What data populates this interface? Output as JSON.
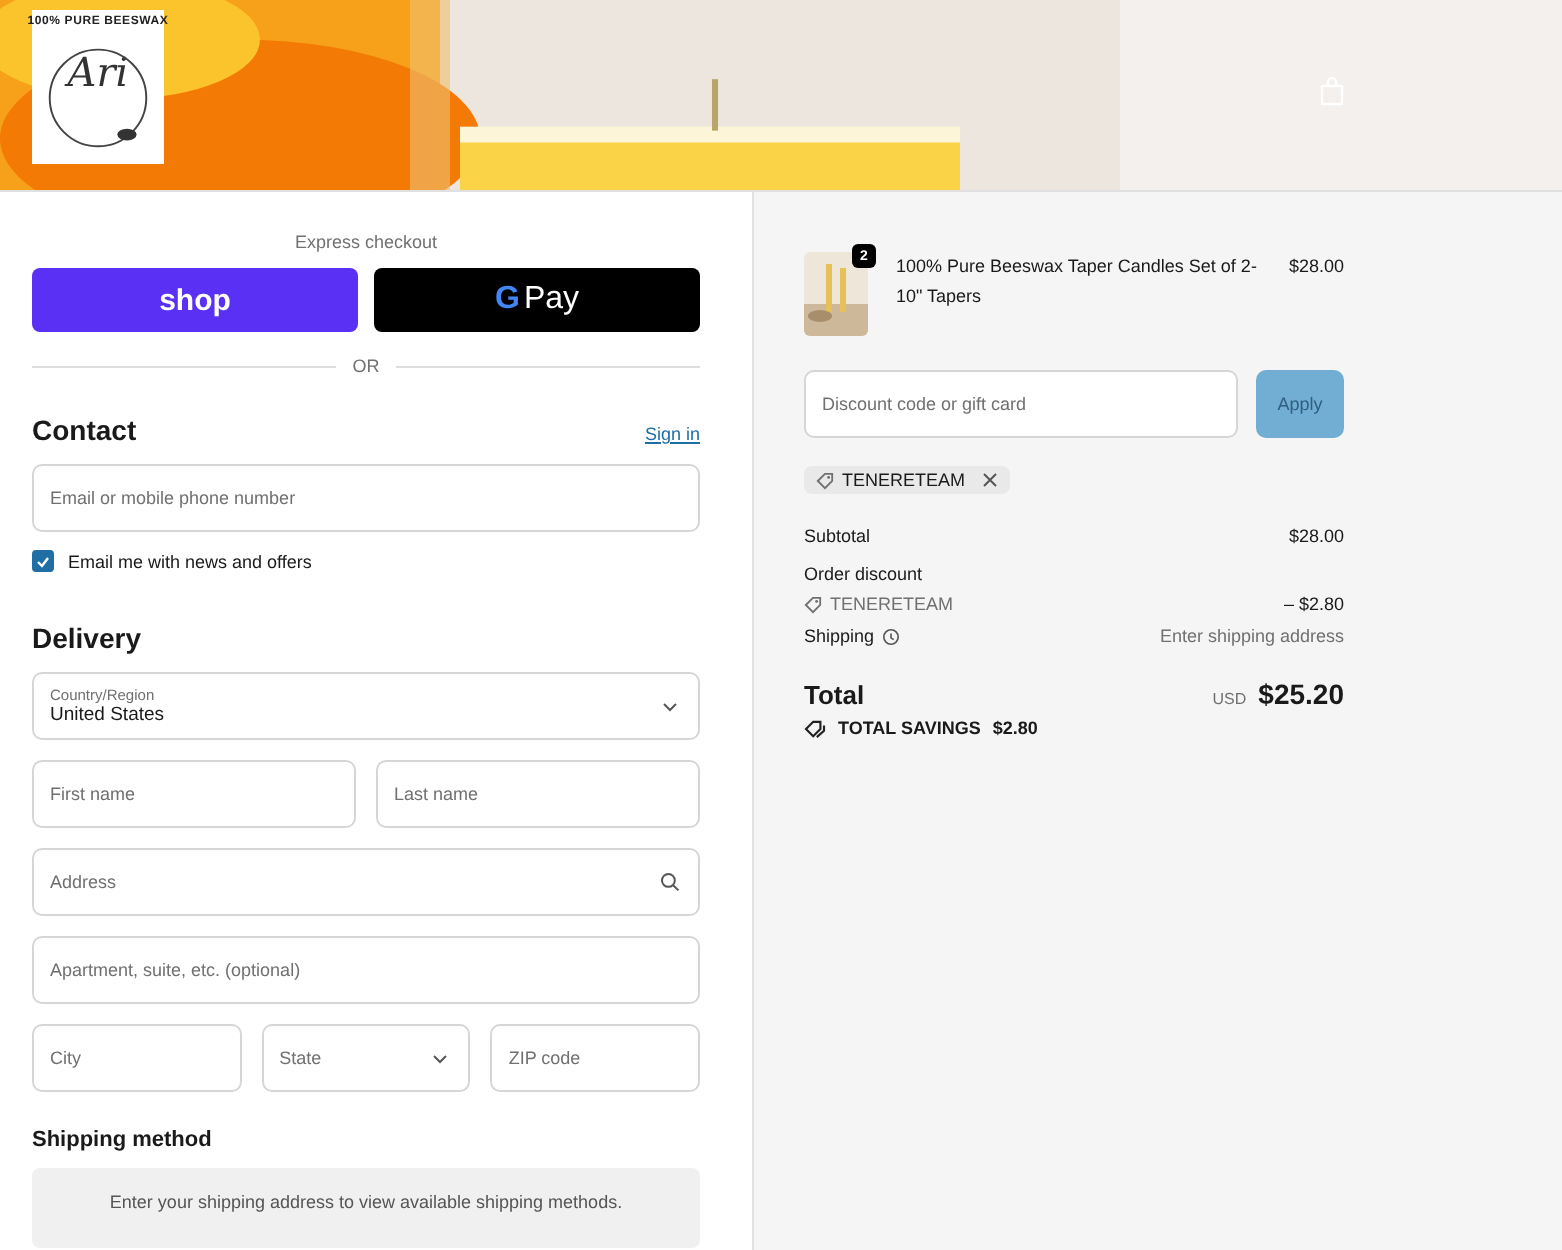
{
  "header": {
    "logo": {
      "arc_text": "100% PURE BEESWAX",
      "script_text": "Ari"
    }
  },
  "express": {
    "title": "Express checkout",
    "shop_label": "shop",
    "gpay": {
      "letter": "G",
      "label": "Pay"
    },
    "divider": "OR"
  },
  "contact": {
    "heading": "Contact",
    "sign_in": "Sign in",
    "email": {
      "placeholder": "Email or mobile phone number"
    },
    "newsletter": {
      "label": "Email me with news and offers",
      "checked": true
    }
  },
  "delivery": {
    "heading": "Delivery",
    "country": {
      "label": "Country/Region",
      "value": "United States"
    },
    "first_name": {
      "placeholder": "First name"
    },
    "last_name": {
      "placeholder": "Last name"
    },
    "address": {
      "placeholder": "Address"
    },
    "apartment": {
      "placeholder": "Apartment, suite, etc. (optional)"
    },
    "city": {
      "placeholder": "City"
    },
    "state": {
      "placeholder": "State"
    },
    "zip": {
      "placeholder": "ZIP code"
    }
  },
  "shipping_method": {
    "heading": "Shipping method",
    "notice": "Enter your shipping address to view available shipping methods."
  },
  "summary": {
    "item": {
      "quantity": "2",
      "name": "100% Pure Beeswax Taper Candles Set of 2- 10\" Tapers",
      "price": "$28.00"
    },
    "discount": {
      "placeholder": "Discount code or gift card",
      "apply": "Apply",
      "apply_disabled": true
    },
    "applied_codes": [
      "TENERETEAM"
    ],
    "subtotal": {
      "label": "Subtotal",
      "value": "$28.00"
    },
    "order_discount": {
      "label": "Order discount",
      "code": "TENERETEAM",
      "value": "– $2.80"
    },
    "shipping": {
      "label": "Shipping",
      "value": "Enter shipping address"
    },
    "total": {
      "label": "Total",
      "currency": "USD",
      "value": "$25.20"
    },
    "savings": {
      "label": "TOTAL SAVINGS",
      "value": "$2.80"
    }
  }
}
